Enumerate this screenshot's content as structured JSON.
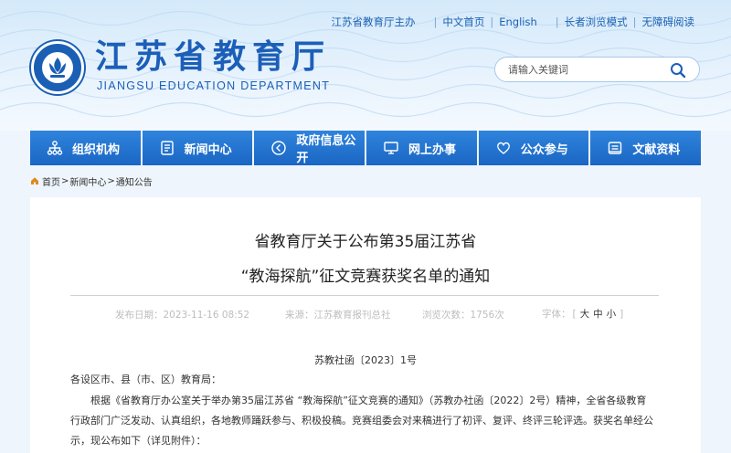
{
  "top_links": {
    "sponsor": "江苏省教育厅主办",
    "home_cn": "中文首页",
    "english": "English",
    "elder_mode": "长者浏览模式",
    "accessible": "无障碍阅读"
  },
  "site": {
    "title": "江苏省教育厅",
    "subtitle": "JIANGSU EDUCATION DEPARTMENT"
  },
  "search": {
    "placeholder": "请输入关键词",
    "icon": "search-icon"
  },
  "nav": {
    "items": [
      {
        "label": "组织机构",
        "icon": "org-chart-icon"
      },
      {
        "label": "新闻中心",
        "icon": "news-doc-icon"
      },
      {
        "label": "政府信息公开",
        "icon": "info-public-icon"
      },
      {
        "label": "网上办事",
        "icon": "monitor-icon"
      },
      {
        "label": "公众参与",
        "icon": "heart-icon"
      },
      {
        "label": "文献资料",
        "icon": "document-icon"
      }
    ]
  },
  "breadcrumb": {
    "home": "首页",
    "news": "新闻中心",
    "notice": "通知公告",
    "separator": ">"
  },
  "article": {
    "title_line1": "省教育厅关于公布第35届江苏省",
    "title_line2": "“教海探航”征文竞赛获奖名单的通知",
    "publish_date": "发布日期：2023-11-16 08:52",
    "source": "来源：江苏教育报刊总社",
    "views": "浏览次数：1756次",
    "font_label": "字体：",
    "font_big": "大",
    "font_mid": "中",
    "font_small": "小",
    "doc_number": "苏教社函〔2023〕1号",
    "salutation": "各设区市、县（市、区）教育局：",
    "para1_line1": "根据《省教育厅办公室关于举办第35届江苏省 “教海探航”征文竞赛的通知》（苏教办社函〔2022〕2号）精神，全省各级教育",
    "para1_line2": "行政部门广泛发动、认真组织，各地教师踊跃参与、积极投稿。竞赛组委会对来稿进行了初评、复评、终评三轮评选。获奖名单经公",
    "para1_line3": "示，现公布如下（详见附件）："
  },
  "colors": {
    "brand_blue": "#1c5fb8",
    "nav_blue": "#1a66c4"
  }
}
